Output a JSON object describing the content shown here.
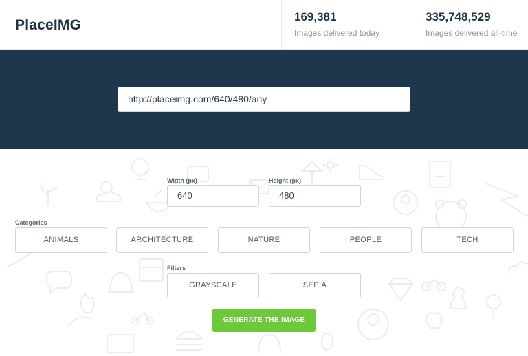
{
  "brand": {
    "logo_text": "PlaceIMG"
  },
  "stats": {
    "today": {
      "number": "169,381",
      "label": "Images delivered today"
    },
    "alltime": {
      "number": "335,748,529",
      "label": "Images delivered all-time"
    }
  },
  "hero": {
    "url_value": "http://placeimg.com/640/480/any"
  },
  "form": {
    "width": {
      "label": "Width (px)",
      "value": "640"
    },
    "height": {
      "label": "Height (px)",
      "value": "480"
    },
    "categories": {
      "label": "Categories",
      "items": [
        "ANIMALS",
        "ARCHITECTURE",
        "NATURE",
        "PEOPLE",
        "TECH"
      ]
    },
    "filters": {
      "label": "Filters",
      "items": [
        "GRAYSCALE",
        "SEPIA"
      ]
    },
    "generate_label": "GENERATE THE IMAGE"
  },
  "colors": {
    "header_bg": "#ffffff",
    "hero_bg": "#1f374c",
    "brand_text": "#1c3348",
    "accent_green": "#6cc93a"
  }
}
